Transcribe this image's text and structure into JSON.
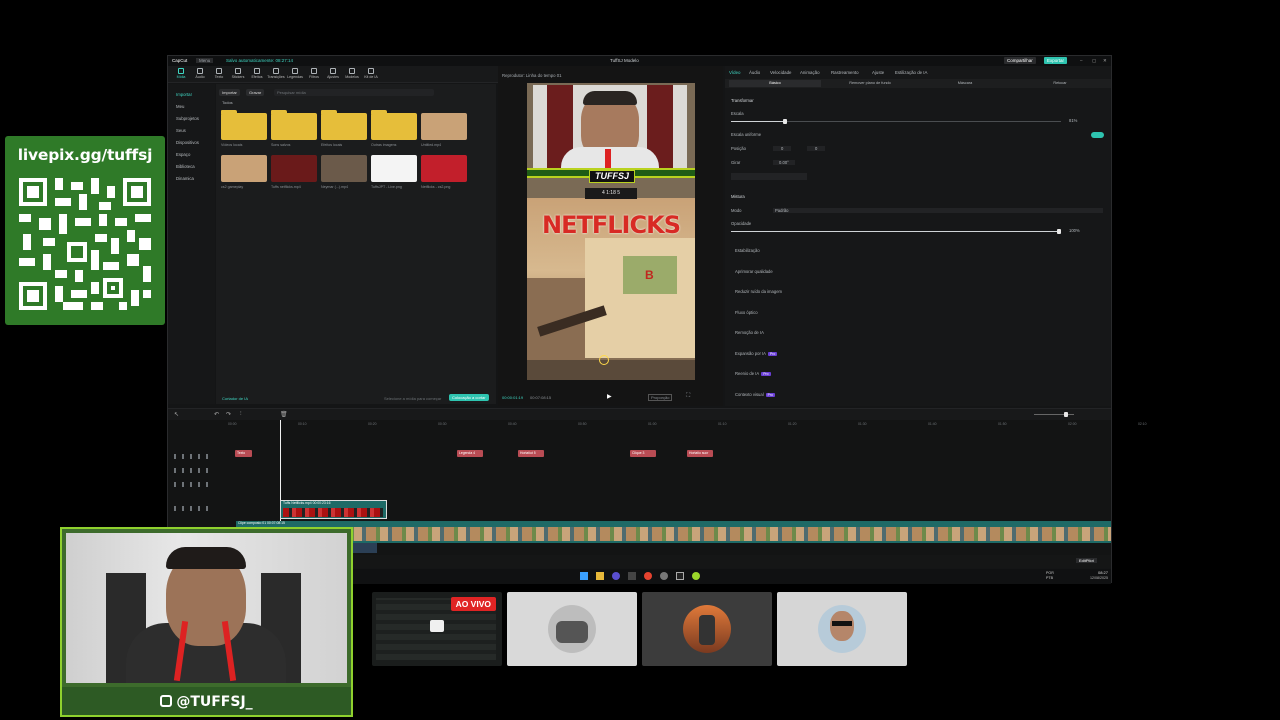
{
  "overlay": {
    "livepix_url": "livepix.gg/tuffsj",
    "social_handle": "@TUFFSJ_",
    "live_badge": "AO VIVO"
  },
  "editor": {
    "app_name": "CapCut",
    "menu_label": "Menu",
    "autosave_text": "Salvo automaticamente: 08:27:14",
    "project_title": "TuffSJ Modelo",
    "share_button": "Compartilhar",
    "export_button": "Exportar",
    "toolbar": [
      {
        "label": "Mídia",
        "icon": "media-icon"
      },
      {
        "label": "Áudio",
        "icon": "audio-icon"
      },
      {
        "label": "Texto",
        "icon": "text-icon"
      },
      {
        "label": "Stickers",
        "icon": "sticker-icon"
      },
      {
        "label": "Efeitos",
        "icon": "effects-icon"
      },
      {
        "label": "Transições",
        "icon": "transitions-icon"
      },
      {
        "label": "Legendas",
        "icon": "captions-icon"
      },
      {
        "label": "Filtros",
        "icon": "filters-icon"
      },
      {
        "label": "Ajustes",
        "icon": "adjust-icon"
      },
      {
        "label": "Modelos",
        "icon": "templates-icon"
      },
      {
        "label": "Kit de IA",
        "icon": "ai-kit-icon"
      }
    ],
    "media_sidebar": [
      "Importar",
      "Meu",
      "Subprojetos",
      "Seus",
      "Dispositivos",
      "Espaço",
      "Biblioteca",
      "Dinamica"
    ],
    "media_tabs": {
      "import": "Importar",
      "record": "Gravar",
      "search_placeholder": "Pesquisar mídia"
    },
    "media_section": "Todos",
    "media_items": [
      {
        "label": "Vídeos locais",
        "kind": "folder"
      },
      {
        "label": "Sons salvos",
        "kind": "folder"
      },
      {
        "label": "Efeitos locais",
        "kind": "folder"
      },
      {
        "label": "Outras imagens",
        "kind": "folder"
      },
      {
        "label": "Untitled.mp4",
        "kind": "video"
      },
      {
        "label": "cs2 gameplay",
        "kind": "video"
      },
      {
        "label": "Tuffs netflicks.mp4",
        "kind": "video"
      },
      {
        "label": "Neymar (...).mp4",
        "kind": "video"
      },
      {
        "label": "TuffsJPT - Live.png",
        "kind": "image"
      },
      {
        "label": "Netflicks - cs2.png",
        "kind": "image"
      }
    ],
    "media_footer": {
      "adjust": "Cortador de IA",
      "info": "Selecione a mídia para começar",
      "action": "Colocação a cortar"
    },
    "player": {
      "label": "Reprodutor: Linha do tempo 01",
      "brand_text": "TUFFSJ",
      "score_text": "4  1:18  5",
      "overlay_title": "NETFLICKS",
      "current_time": "00:00:01:19",
      "total_time": "00:07:08:15",
      "ratio_label": "Proporção"
    },
    "properties": {
      "tabs": [
        "Vídeo",
        "Áudio",
        "Velocidade",
        "Animação",
        "Rastreamento",
        "Ajuste",
        "Estilização de IA"
      ],
      "subtabs": [
        "Básico",
        "Remover plano de fundo",
        "Máscara",
        "Retocar"
      ],
      "transform_title": "Transformar",
      "scale_label": "Escala",
      "scale_value": "81%",
      "uniform_scale_label": "Escala uniforme",
      "position_label": "Posição",
      "position_x": "0",
      "position_y": "0",
      "rotate_label": "Girar",
      "rotate_value": "0.00°",
      "blend_title": "Mistura",
      "mode_label": "Modo",
      "mode_value": "Padrão",
      "opacity_label": "Opacidade",
      "opacity_value": "100%",
      "sections": [
        {
          "label": "Estabilização",
          "tag": ""
        },
        {
          "label": "Aprimorar qualidade",
          "tag": ""
        },
        {
          "label": "Reduzir ruído da imagem",
          "tag": ""
        },
        {
          "label": "Fluxo óptico",
          "tag": ""
        },
        {
          "label": "Remoção de IA",
          "tag": ""
        },
        {
          "label": "Expansão por IA",
          "tag": "Pro"
        },
        {
          "label": "Reenio de IA",
          "tag": "Pro"
        },
        {
          "label": "Contexto visual",
          "tag": "Pro"
        }
      ]
    },
    "timeline": {
      "ruler": [
        "00:00",
        "00:10",
        "00:20",
        "00:30",
        "00:40",
        "00:50",
        "01:00",
        "01:10",
        "01:20",
        "01:30",
        "01:40",
        "01:50",
        "02:00",
        "02:10"
      ],
      "text_clips": [
        "Texto",
        "Legenda 4",
        "Hortatiut 5",
        "Clique 3",
        "Hortatio sucr"
      ],
      "overlay_clip": "Tuffs Netflicks.mp4  00:00:23:16",
      "main_clip": "Clipe composto 01  00:07:08:15",
      "bottom_right": "EditPilot"
    },
    "taskbar": {
      "lang": "POR PTB",
      "time": "08:27",
      "date": "12/08/2025"
    }
  }
}
